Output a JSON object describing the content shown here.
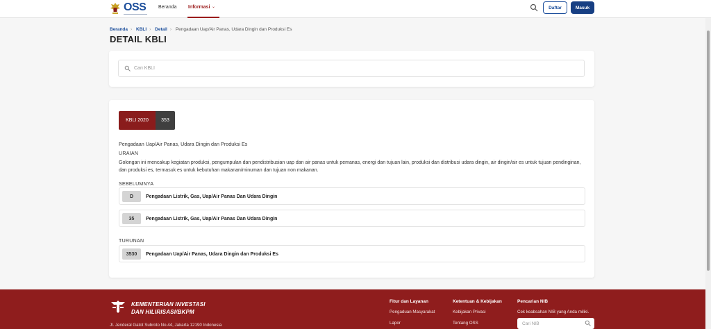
{
  "navbar": {
    "nav_items": [
      "Beranda",
      "Informasi"
    ],
    "buttons": {
      "daftar": "Daftar",
      "masuk": "Masuk"
    }
  },
  "breadcrumb": [
    "Beranda",
    "KBLI",
    "Detail",
    "Pengadaan Uap/Air Panas, Udara Dingin dan Produksi Es"
  ],
  "page_title": "DETAIL KBLI",
  "search": {
    "placeholder": "Cari KBLI"
  },
  "kbli": {
    "version": "KBLI 2020",
    "code": "353",
    "name": "Pengadaan Uap/Air Panas, Udara Dingin dan Produksi Es",
    "uraian_label": "URAIAN",
    "uraian": "Golongan ini mencakup kegiatan produksi, pengumpulan dan pendistribusian uap dan air panas untuk pemanas, energi dan tujuan lain, produksi dan distribusi udara dingin, air dingin/air es untuk tujuan pendinginan, dan produksi es, termasuk es untuk kebutuhan makanan/minuman dan tujuan non makanan.",
    "sebelumnya_label": "SEBELUMNYA",
    "sebelumnya": [
      {
        "code": "D",
        "title": "Pengadaan Listrik, Gas, Uap/Air Panas Dan Udara Dingin"
      },
      {
        "code": "35",
        "title": "Pengadaan Listrik, Gas, Uap/Air Panas Dan Udara Dingin"
      }
    ],
    "turunan_label": "TURUNAN",
    "turunan": [
      {
        "code": "3530",
        "title": "Pengadaan Uap/Air Panas, Udara Dingin dan Produksi Es"
      }
    ]
  },
  "footer": {
    "ministry_line1": "KEMENTERIAN INVESTASI",
    "ministry_line2": "DAN HILIRISASI/BKPM",
    "address": "Jl. Jenderal Gatot Subroto No.44, Jakarta 12190 Indonesia",
    "columns": [
      {
        "title": "Fitur dan Layanan",
        "links": [
          "Pengaduan Masyarakat",
          "Lapor"
        ]
      },
      {
        "title": "Ketentuan & Kebijakan",
        "links": [
          "Kebijakan Privasi",
          "Tentang OSS"
        ]
      },
      {
        "title": "Pencarian NIB",
        "links": [
          "Cek keabsahan NIB yang Anda miliki."
        ]
      }
    ],
    "nib_placeholder": "Cari NIB"
  },
  "colors": {
    "brand_red": "#8f1d1d",
    "brand_blue": "#1d4f9c",
    "dark_badge": "#3f3f3f"
  },
  "icons": [
    "garuda-emblem-icon",
    "oss-logo",
    "chevron-down-icon",
    "search-icon",
    "kementerian-logo-icon"
  ]
}
